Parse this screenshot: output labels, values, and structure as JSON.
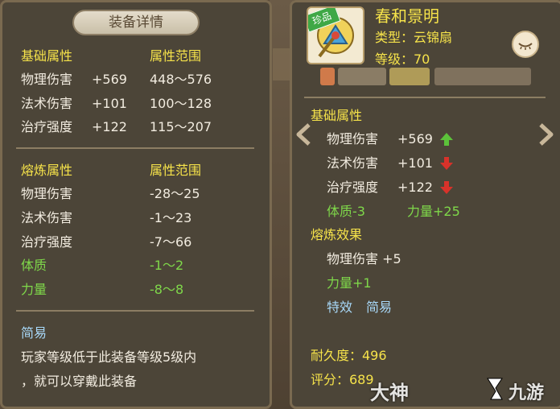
{
  "left": {
    "title": "装备详情",
    "base_header": "基础属性",
    "base_range_header": "属性范围",
    "base_rows": [
      {
        "name": "物理伤害",
        "value": "+569",
        "range": "448～576"
      },
      {
        "name": "法术伤害",
        "value": "+101",
        "range": "100～128"
      },
      {
        "name": "治疗强度",
        "value": "+122",
        "range": "115～207"
      }
    ],
    "refine_header": "熔炼属性",
    "refine_range_header": "属性范围",
    "refine_rows": [
      {
        "name": "物理伤害",
        "range": "-28～25"
      },
      {
        "name": "法术伤害",
        "range": "-1～23"
      },
      {
        "name": "治疗强度",
        "range": "-7～66"
      },
      {
        "name": "体质",
        "range": "-1～2"
      },
      {
        "name": "力量",
        "range": "-8～8"
      }
    ],
    "special_name": "简易",
    "special_desc_1": "玩家等级低于此装备等级5级内",
    "special_desc_2": "，就可以穿戴此装备"
  },
  "right": {
    "rarity_badge": "珍品",
    "item_name": "春和景明",
    "type_line": "类型：云锦扇",
    "level_line": "等级：70",
    "base_header": "基础属性",
    "base_rows": [
      {
        "name": "物理伤害",
        "value": "+569",
        "trend": "up"
      },
      {
        "name": "法术伤害",
        "value": "+101",
        "trend": "down"
      },
      {
        "name": "治疗强度",
        "value": "+122",
        "trend": "down"
      }
    ],
    "stat_a": "体质-3",
    "stat_b": "力量+25",
    "refine_header": "熔炼效果",
    "refine_row": "物理伤害 +5",
    "refine_power": "力量+1",
    "special_label": "特效",
    "special_value": "简易",
    "durability": "耐久度：496",
    "score": "评分：689"
  },
  "watermark": {
    "left": "大神",
    "right": "九游"
  },
  "colors": {
    "yellow": "#f6e34a",
    "green": "#7fd84a",
    "blue": "#a8d8f8",
    "up": "#5cc23a",
    "down": "#d8322a"
  }
}
